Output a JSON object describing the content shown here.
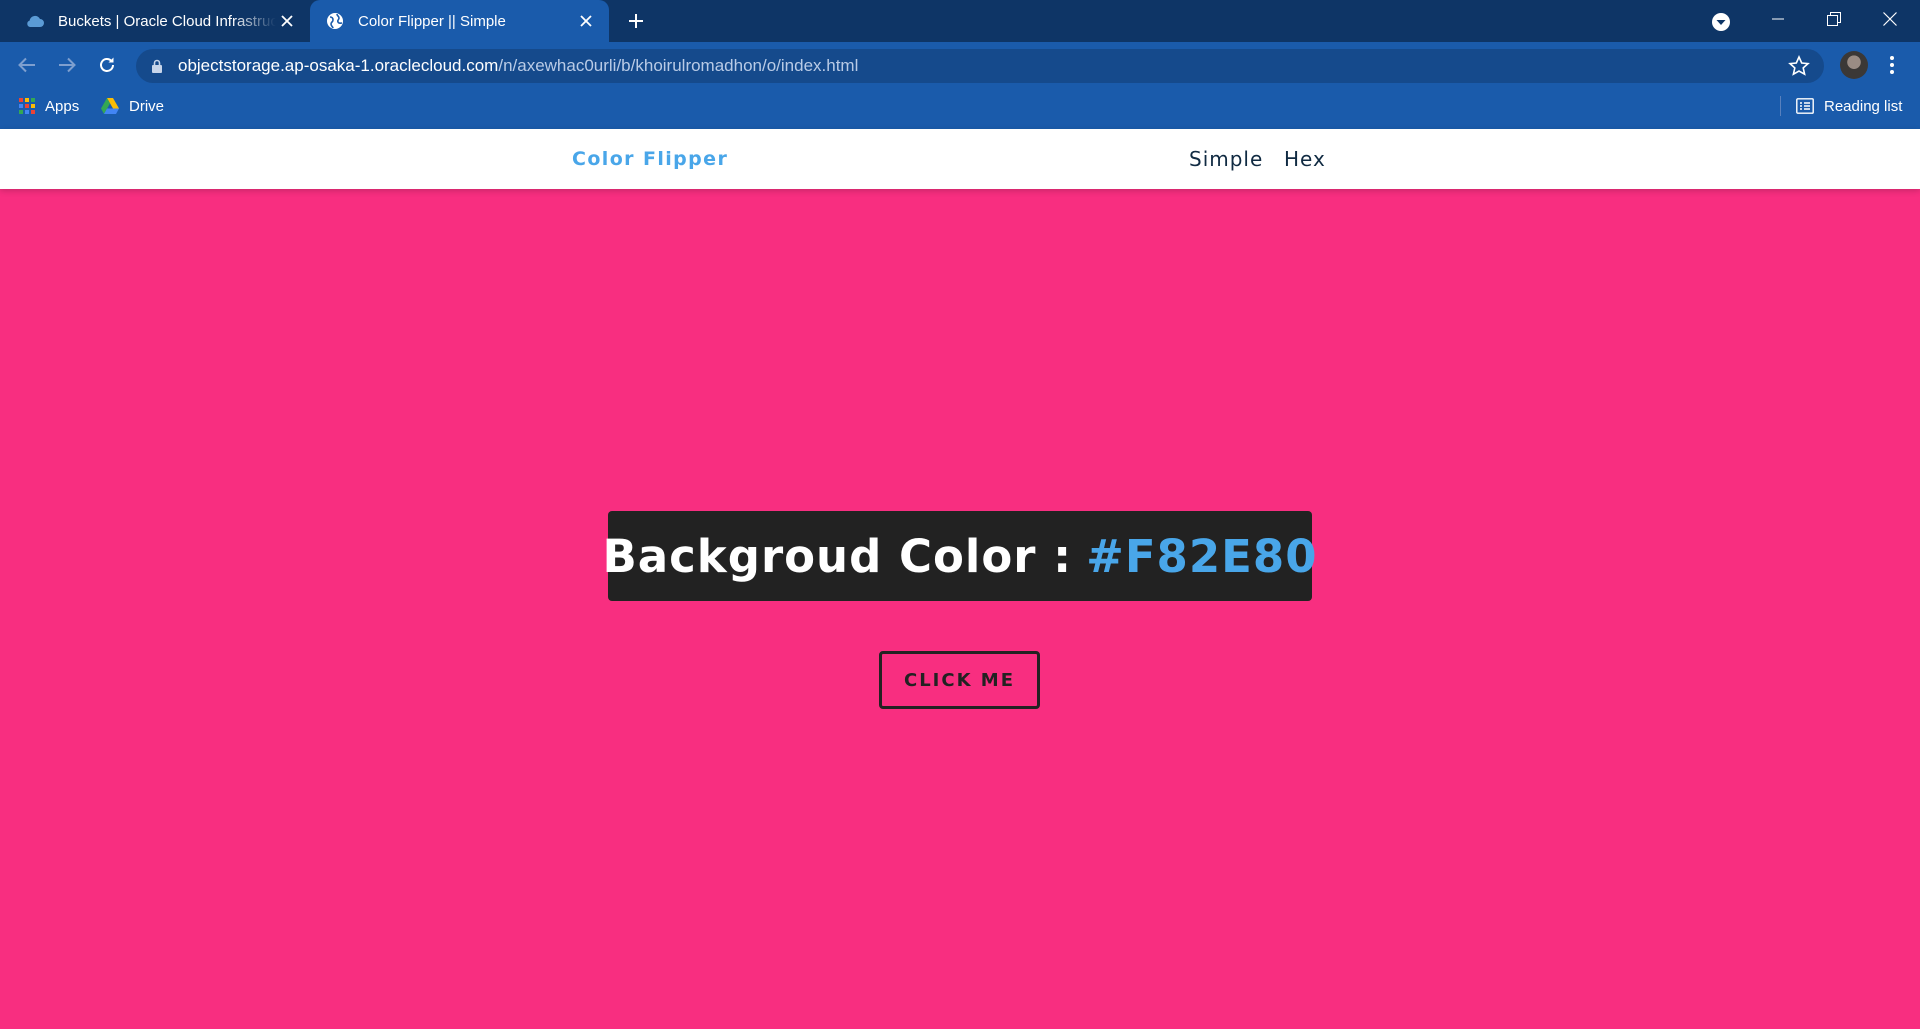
{
  "browser": {
    "tabs": [
      {
        "title": "Buckets | Oracle Cloud Infrastructure",
        "icon": "cloud-icon",
        "active": false
      },
      {
        "title": "Color Flipper || Simple",
        "icon": "globe-icon",
        "active": true
      }
    ],
    "address": {
      "host": "objectstorage.ap-osaka-1.oraclecloud.com",
      "path": "/n/axewhac0urli/b/khoirulromadhon/o/index.html"
    },
    "bookmarks": [
      {
        "label": "Apps",
        "icon": "apps-grid-icon"
      },
      {
        "label": "Drive",
        "icon": "drive-icon"
      }
    ],
    "reading_list": "Reading list"
  },
  "page": {
    "brand": "Color Flipper",
    "nav": [
      "Simple",
      "Hex"
    ],
    "label": "Backgroud Color :",
    "color_value": "#F82E80",
    "button": "CLICK ME"
  },
  "colors": {
    "page_background": "#F82E80",
    "brand_accent": "#49a6e9",
    "dark": "#222222",
    "nav_text": "#102a42",
    "chrome_tabstrip": "#0e3566",
    "chrome_toolbar": "#1a5bab"
  }
}
